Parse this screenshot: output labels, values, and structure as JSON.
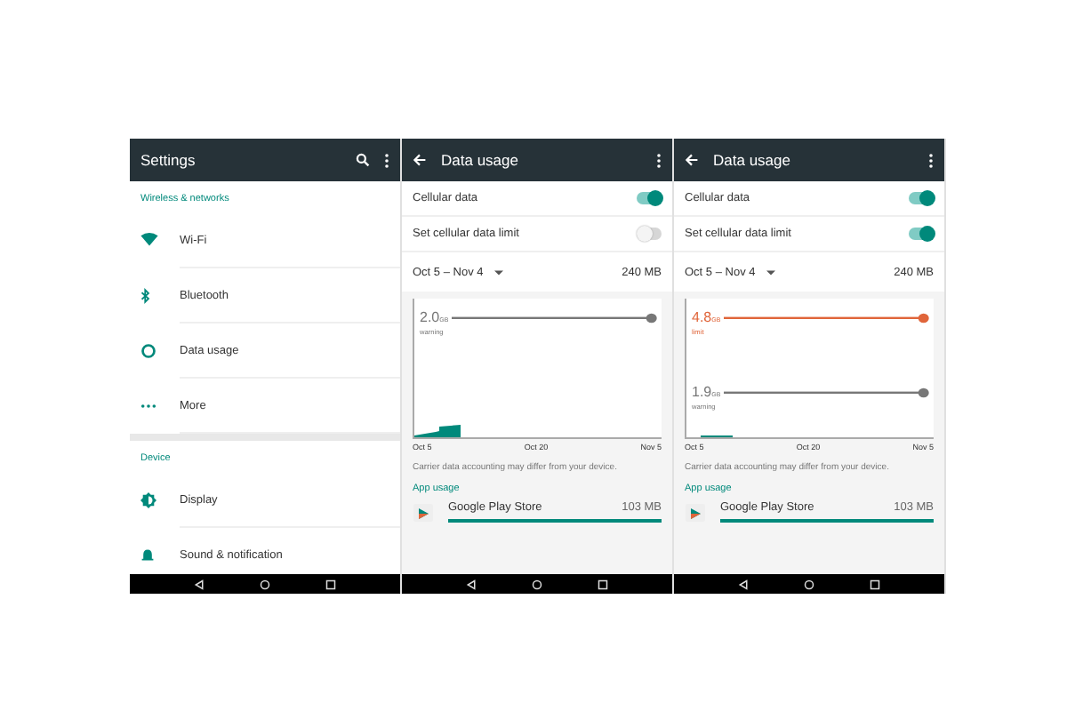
{
  "screens": [
    {
      "kind": "settings",
      "title": "Settings",
      "sections": [
        {
          "header": "Wireless & networks",
          "items": [
            {
              "kind": "wifi",
              "label": "Wi-Fi"
            },
            {
              "kind": "bluetooth",
              "label": "Bluetooth"
            },
            {
              "kind": "data",
              "label": "Data usage"
            },
            {
              "kind": "more",
              "label": "More"
            }
          ]
        },
        {
          "header": "Device",
          "items": [
            {
              "kind": "display",
              "label": "Display"
            },
            {
              "kind": "bell",
              "label": "Sound & notification"
            }
          ]
        }
      ]
    },
    {
      "kind": "data_usage",
      "title": "Data usage",
      "toggles": [
        {
          "label": "Cellular data",
          "on": true
        },
        {
          "label": "Set cellular data limit",
          "on": false
        }
      ],
      "period": "Oct 5 – Nov 4",
      "total": "240 MB",
      "lines": [
        {
          "kind": "warning",
          "value": "2.0",
          "unit": "GB",
          "label": "warning"
        }
      ],
      "x_labels": [
        "Oct 5",
        "Oct 20",
        "Nov 5"
      ],
      "note": "Carrier data accounting may differ from your device.",
      "app_header": "App usage",
      "apps": [
        {
          "name": "Google Play Store",
          "size": "103 MB",
          "level": 1
        }
      ]
    },
    {
      "kind": "data_usage",
      "title": "Data usage",
      "toggles": [
        {
          "label": "Cellular data",
          "on": true
        },
        {
          "label": "Set cellular data limit",
          "on": true
        }
      ],
      "period": "Oct 5 – Nov 4",
      "total": "240 MB",
      "lines": [
        {
          "kind": "limit",
          "value": "4.8",
          "unit": "GB",
          "label": "limit"
        },
        {
          "kind": "warning",
          "value": "1.9",
          "unit": "GB",
          "label": "warning"
        }
      ],
      "x_labels": [
        "Oct 5",
        "Oct 20",
        "Nov 5"
      ],
      "note": "Carrier data accounting may differ from your device.",
      "app_header": "App usage",
      "apps": [
        {
          "name": "Google Play Store",
          "size": "103 MB",
          "level": 1
        }
      ]
    }
  ]
}
